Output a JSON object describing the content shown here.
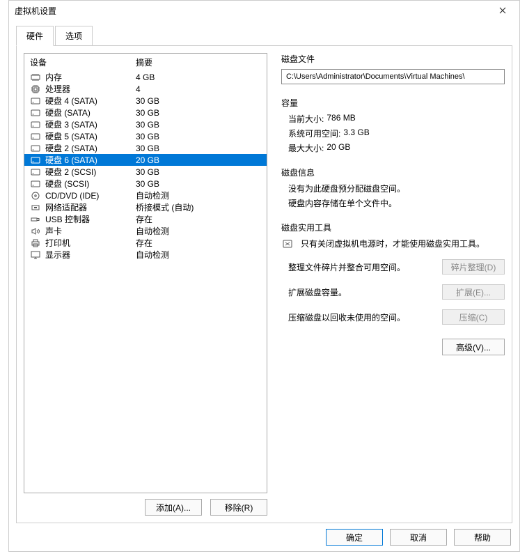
{
  "window": {
    "title": "虚拟机设置"
  },
  "tabs": {
    "hardware": "硬件",
    "options": "选项"
  },
  "list_header": {
    "device": "设备",
    "summary": "摘要"
  },
  "devices": [
    {
      "icon": "memory-icon",
      "name": "内存",
      "summary": "4 GB"
    },
    {
      "icon": "cpu-icon",
      "name": "处理器",
      "summary": "4"
    },
    {
      "icon": "hdd-icon",
      "name": "硬盘 4 (SATA)",
      "summary": "30 GB"
    },
    {
      "icon": "hdd-icon",
      "name": "硬盘 (SATA)",
      "summary": "30 GB"
    },
    {
      "icon": "hdd-icon",
      "name": "硬盘 3 (SATA)",
      "summary": "30 GB"
    },
    {
      "icon": "hdd-icon",
      "name": "硬盘 5 (SATA)",
      "summary": "30 GB"
    },
    {
      "icon": "hdd-icon",
      "name": "硬盘 2 (SATA)",
      "summary": "30 GB"
    },
    {
      "icon": "hdd-icon",
      "name": "硬盘 6 (SATA)",
      "summary": "20 GB",
      "selected": true
    },
    {
      "icon": "hdd-icon",
      "name": "硬盘 2 (SCSI)",
      "summary": "30 GB"
    },
    {
      "icon": "hdd-icon",
      "name": "硬盘 (SCSI)",
      "summary": "30 GB"
    },
    {
      "icon": "cd-icon",
      "name": "CD/DVD (IDE)",
      "summary": "自动检测"
    },
    {
      "icon": "network-icon",
      "name": "网络适配器",
      "summary": "桥接模式 (自动)"
    },
    {
      "icon": "usb-icon",
      "name": "USB 控制器",
      "summary": "存在"
    },
    {
      "icon": "sound-icon",
      "name": "声卡",
      "summary": "自动检测"
    },
    {
      "icon": "printer-icon",
      "name": "打印机",
      "summary": "存在"
    },
    {
      "icon": "display-icon",
      "name": "显示器",
      "summary": "自动检测"
    }
  ],
  "buttons": {
    "add": "添加(A)...",
    "remove": "移除(R)"
  },
  "disk_file": {
    "title": "磁盘文件",
    "path": "C:\\Users\\Administrator\\Documents\\Virtual Machines\\"
  },
  "capacity": {
    "title": "容量",
    "current_size_label": "当前大小:",
    "current_size": "786 MB",
    "system_free_label": "系统可用空间:",
    "system_free": "3.3 GB",
    "max_size_label": "最大大小:",
    "max_size": "20 GB"
  },
  "disk_info": {
    "title": "磁盘信息",
    "line1": "没有为此硬盘预分配磁盘空间。",
    "line2": "硬盘内容存储在单个文件中。"
  },
  "disk_util": {
    "title": "磁盘实用工具",
    "warning": "只有关闭虚拟机电源时，才能使用磁盘实用工具。",
    "defrag_text": "整理文件碎片并整合可用空间。",
    "defrag_btn": "碎片整理(D)",
    "expand_text": "扩展磁盘容量。",
    "expand_btn": "扩展(E)...",
    "compact_text": "压缩磁盘以回收未使用的空间。",
    "compact_btn": "压缩(C)"
  },
  "advanced_btn": "高级(V)...",
  "footer": {
    "ok": "确定",
    "cancel": "取消",
    "help": "帮助"
  }
}
